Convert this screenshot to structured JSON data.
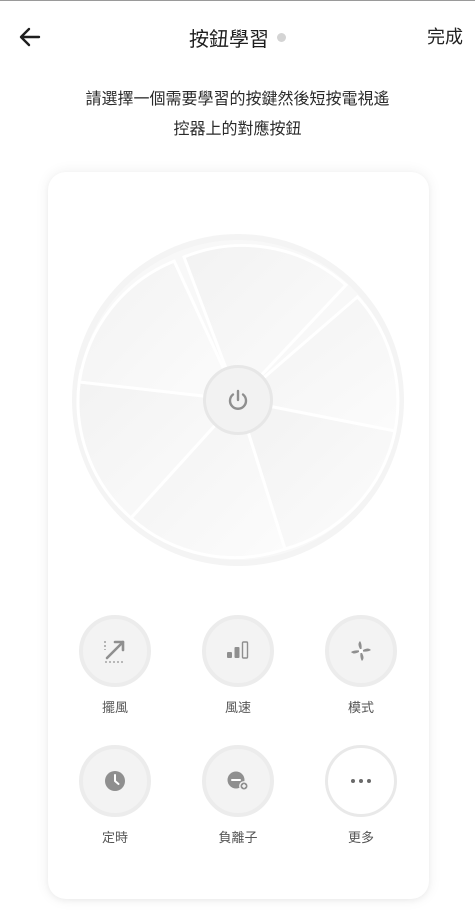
{
  "header": {
    "title": "按鈕學習",
    "done_label": "完成"
  },
  "instructions": {
    "line1": "請選擇一個需要學習的按鍵然後短按電視遙",
    "line2": "控器上的對應按鈕"
  },
  "controls": [
    {
      "label": "擺風",
      "icon": "swing-icon"
    },
    {
      "label": "風速",
      "icon": "fan-speed-icon"
    },
    {
      "label": "模式",
      "icon": "mode-fan-icon"
    },
    {
      "label": "定時",
      "icon": "clock-icon"
    },
    {
      "label": "負離子",
      "icon": "anion-icon"
    },
    {
      "label": "更多",
      "icon": "more-icon"
    }
  ],
  "colors": {
    "icon_gray": "#8f8f8f",
    "button_fill": "#f3f3f3",
    "fan_fill": "#f7f7f7"
  }
}
